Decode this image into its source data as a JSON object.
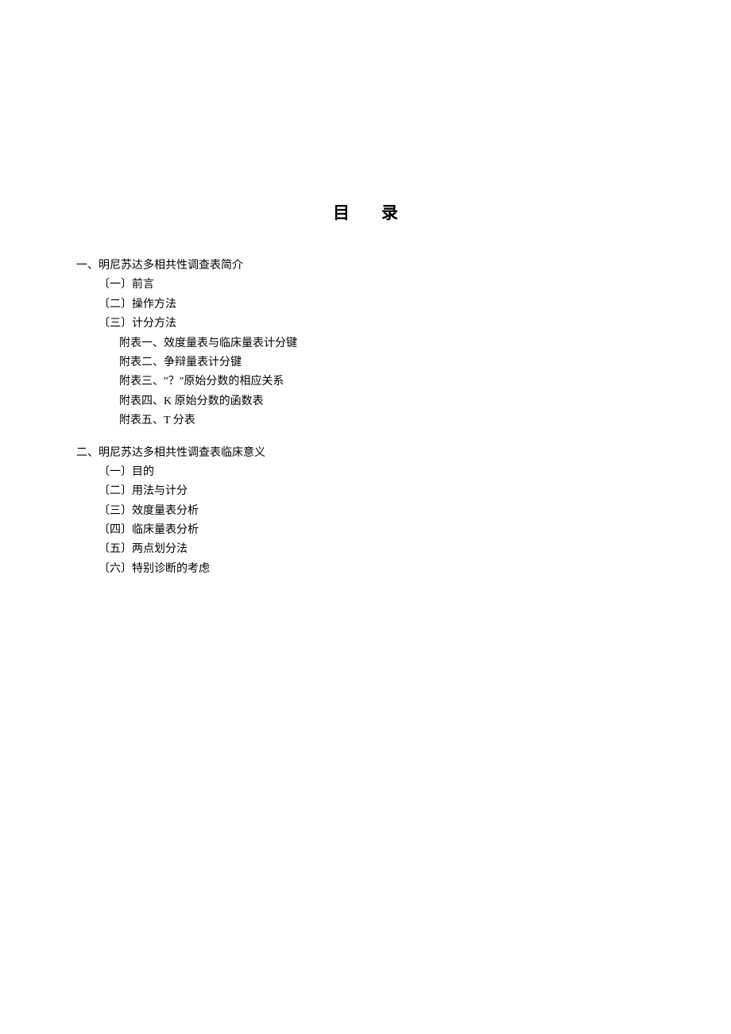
{
  "title": "目录",
  "sections": [
    {
      "heading": "一、明尼苏达多相共性调查表简介",
      "subs": [
        {
          "text": "〔一〕前言"
        },
        {
          "text": "〔二〕操作方法"
        },
        {
          "text": "〔三〕计分方法"
        }
      ],
      "appendices": [
        {
          "text": "附表一、效度量表与临床量表计分键"
        },
        {
          "text": "附表二、争辩量表计分键"
        },
        {
          "text": "附表三、\"？\"原始分数的相应关系"
        },
        {
          "text": "附表四、K 原始分数的函数表"
        },
        {
          "text": "附表五、T 分表"
        }
      ]
    },
    {
      "heading": "二、明尼苏达多相共性调查表临床意义",
      "subs": [
        {
          "text": "〔一〕目的"
        },
        {
          "text": "〔二〕用法与计分"
        },
        {
          "text": "〔三〕效度量表分析"
        },
        {
          "text": "〔四〕临床量表分析"
        },
        {
          "text": "〔五〕两点划分法"
        },
        {
          "text": "〔六〕特别诊断的考虑"
        }
      ],
      "appendices": []
    }
  ]
}
